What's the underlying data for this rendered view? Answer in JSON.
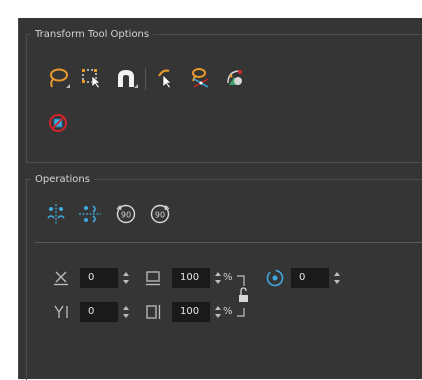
{
  "transform_tool_options": {
    "title": "Transform Tool Options",
    "tools": [
      {
        "icon": "lasso-select-icon"
      },
      {
        "icon": "marquee-select-icon"
      },
      {
        "icon": "snap-magnet-icon"
      },
      {
        "icon": "peg-select-icon"
      },
      {
        "icon": "pivot-edit-icon"
      },
      {
        "icon": "apply-to-all-icon"
      },
      {
        "icon": "flatten-icon"
      }
    ]
  },
  "operations": {
    "title": "Operations",
    "buttons": [
      {
        "icon": "flip-horizontal-icon"
      },
      {
        "icon": "flip-vertical-icon"
      },
      {
        "icon": "rotate-90-ccw-icon"
      },
      {
        "icon": "rotate-90-cw-icon"
      }
    ]
  },
  "fields": {
    "x_offset": "0",
    "y_offset": "0",
    "width": "100",
    "height": "100",
    "angle": "0",
    "width_unit": "%",
    "height_unit": "%"
  },
  "colors": {
    "panel_bg": "#353535",
    "field_bg": "#1a1a1a",
    "accent_blue": "#3fa9e0",
    "accent_orange": "#e89a2c",
    "accent_red": "#d0252a"
  }
}
